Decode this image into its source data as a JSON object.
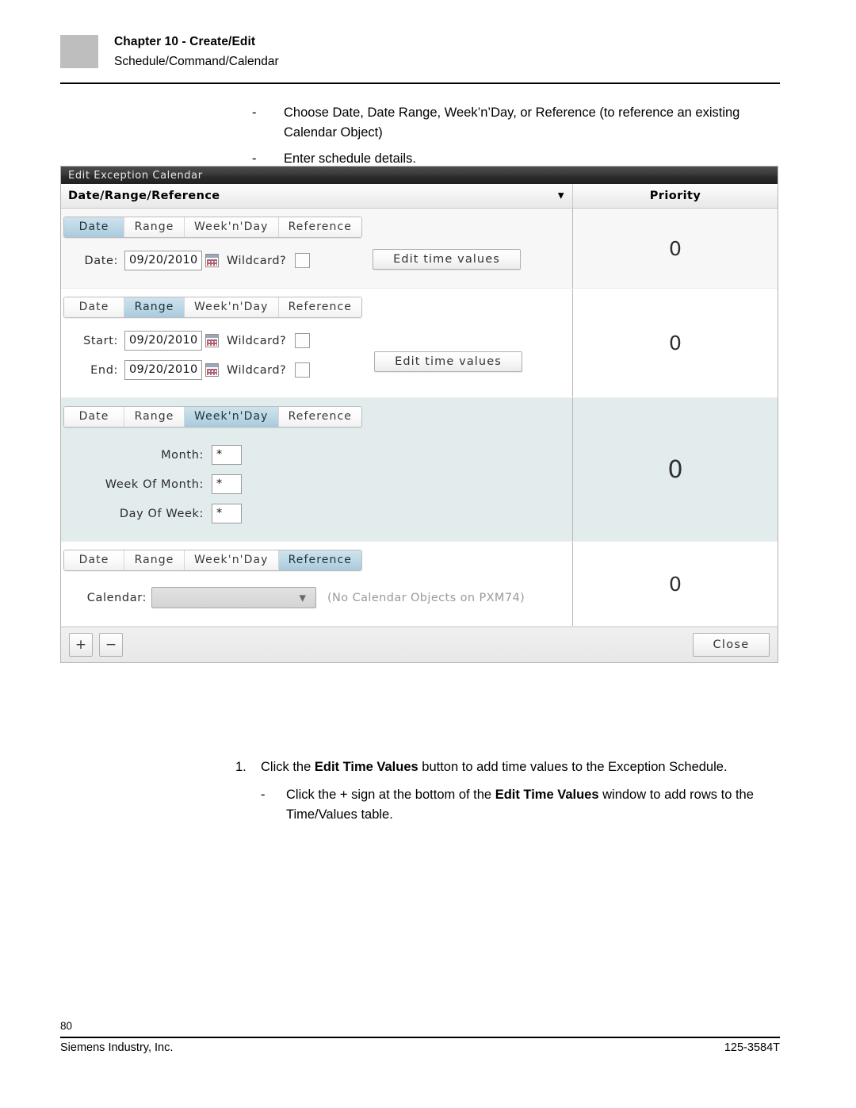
{
  "page_header": {
    "chapter_title": "Chapter 10 - Create/Edit",
    "chapter_subtitle": "Schedule/Command/Calendar"
  },
  "intro_bullets": [
    {
      "marker": "-",
      "text": "Choose Date, Date Range, Week’n’Day, or Reference (to reference an existing Calendar Object)"
    },
    {
      "marker": "-",
      "text": "Enter schedule details."
    }
  ],
  "dialog": {
    "title": "Edit Exception Calendar",
    "column_headers": {
      "left": "Date/Range/Reference",
      "sort_arrow": "▼",
      "right": "Priority"
    },
    "tab_labels": [
      "Date",
      "Range",
      "Week'n'Day",
      "Reference"
    ],
    "rows": [
      {
        "active_tab": "Date",
        "priority": "0",
        "fields": [
          {
            "label": "Date:",
            "value": "09/20/2010",
            "wildcard_label": "Wildcard?",
            "wildcard_checked": false
          }
        ],
        "button": "Edit time values"
      },
      {
        "active_tab": "Range",
        "priority": "0",
        "fields": [
          {
            "label": "Start:",
            "value": "09/20/2010",
            "wildcard_label": "Wildcard?",
            "wildcard_checked": false
          },
          {
            "label": "End:",
            "value": "09/20/2010",
            "wildcard_label": "Wildcard?",
            "wildcard_checked": false
          }
        ],
        "button": "Edit time values"
      },
      {
        "active_tab": "Week'n'Day",
        "priority": "0",
        "fields": [
          {
            "label": "Month:",
            "value": "*"
          },
          {
            "label": "Week Of Month:",
            "value": "*"
          },
          {
            "label": "Day Of Week:",
            "value": "*"
          }
        ]
      },
      {
        "active_tab": "Reference",
        "priority": "0",
        "fields": [
          {
            "label": "Calendar:",
            "value": "",
            "hint": "(No Calendar Objects on PXM74)"
          }
        ]
      }
    ],
    "footer": {
      "add_label": "+",
      "remove_label": "−",
      "close_label": "Close"
    }
  },
  "steps": {
    "numbered": {
      "marker": "1.",
      "part1": "Click the ",
      "bold1": "Edit Time Values",
      "part2": " button to add time values to the Exception Schedule."
    },
    "sub": {
      "marker": "-",
      "part1": "Click the + sign at the bottom of the ",
      "bold1": "Edit Time Values",
      "part2": " window to add rows to the Time/Values table."
    }
  },
  "page_footer": {
    "page_number": "80",
    "company": "Siemens Industry, Inc.",
    "doc_number": "125-3584T"
  }
}
